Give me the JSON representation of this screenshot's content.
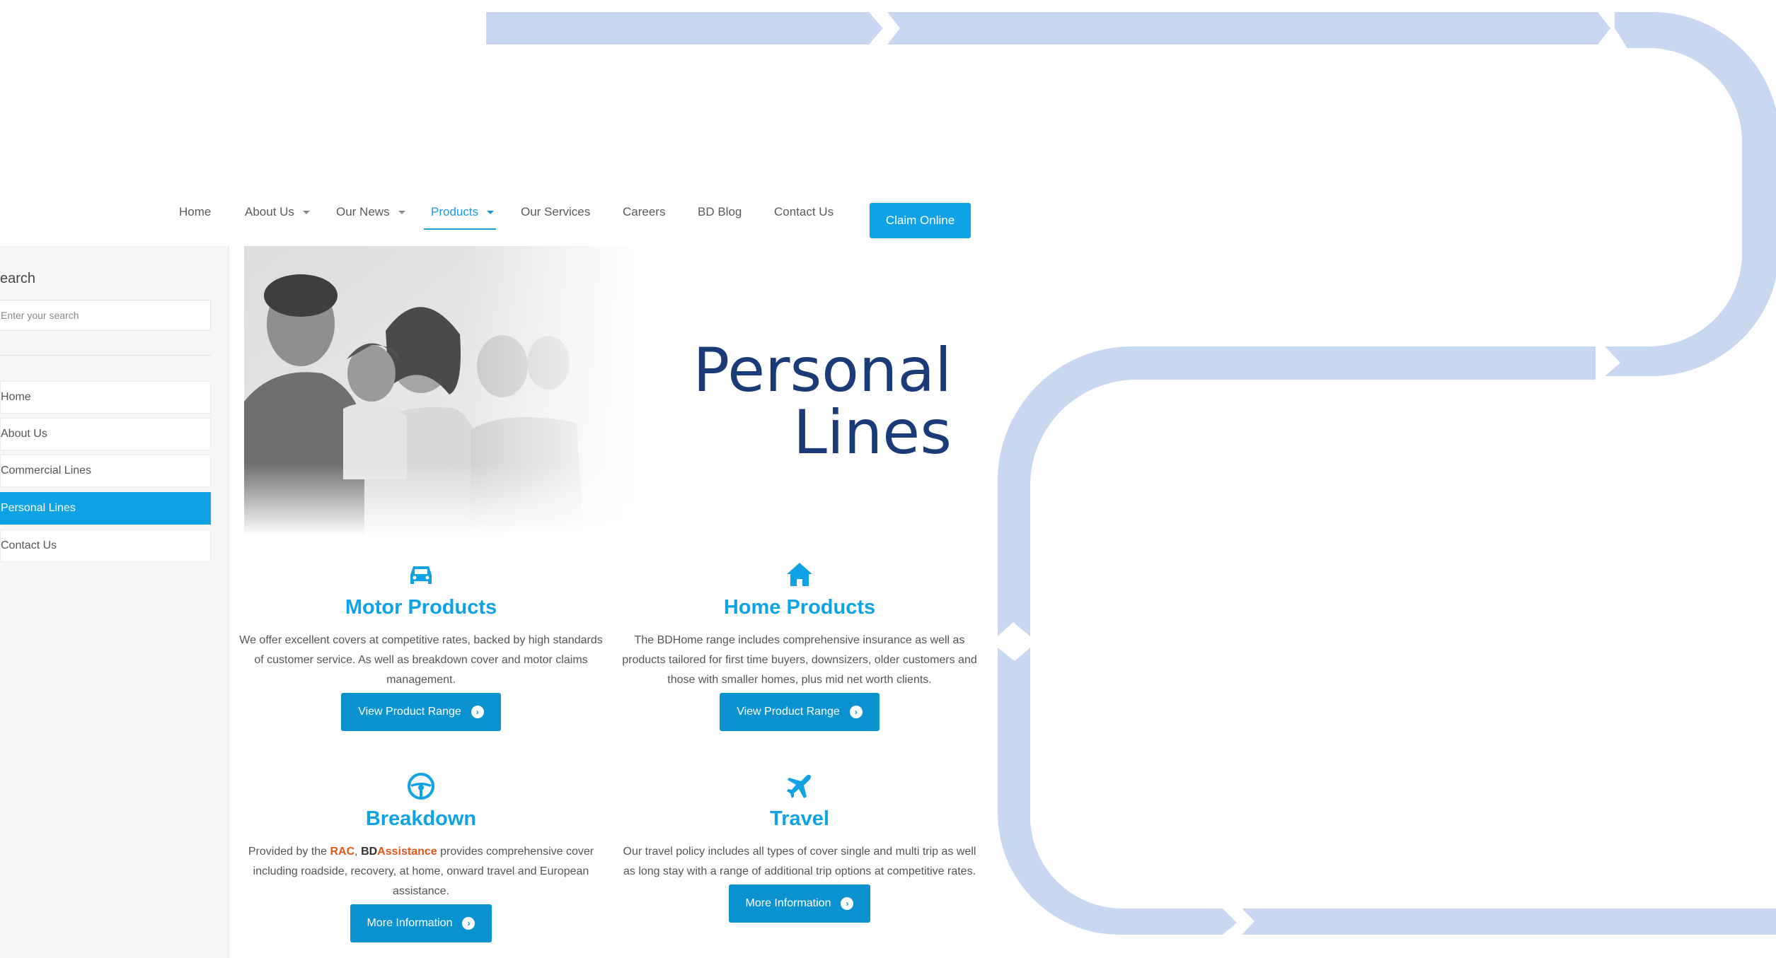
{
  "nav": {
    "items": [
      {
        "label": "Home"
      },
      {
        "label": "About Us"
      },
      {
        "label": "Our News"
      },
      {
        "label": "Products"
      },
      {
        "label": "Our Services"
      },
      {
        "label": "Careers"
      },
      {
        "label": "BD Blog"
      },
      {
        "label": "Contact Us"
      }
    ],
    "active": "Products",
    "claim_label": "Claim Online"
  },
  "sidebar": {
    "search_title": "earch",
    "search_placeholder": "Enter your search",
    "items": [
      {
        "label": "Home"
      },
      {
        "label": "About Us"
      },
      {
        "label": "Commercial Lines"
      },
      {
        "label": "Personal Lines"
      },
      {
        "label": "Contact Us"
      }
    ],
    "active": "Personal Lines"
  },
  "hero": {
    "title_line1": "Personal",
    "title_line2": "Lines"
  },
  "products": [
    {
      "icon": "car-icon",
      "title": "Motor Products",
      "desc": "We offer excellent covers at competitive rates, backed by high standards of customer service. As well as breakdown cover and motor claims management.",
      "button": "View Product Range"
    },
    {
      "icon": "home-icon",
      "title": "Home Products",
      "desc": "The BDHome range includes comprehensive insurance as well as products tailored for first time buyers, downsizers, older customers and those with smaller homes, plus mid net worth clients.",
      "button": "View Product Range"
    },
    {
      "icon": "steering-wheel-icon",
      "title": "Breakdown",
      "desc_prefix": "Provided by the ",
      "desc_rac": "RAC",
      "desc_sep": ", ",
      "desc_bd": "BD",
      "desc_assist": "Assistance",
      "desc_rest": " provides comprehensive cover including roadside, recovery, at home, onward travel and European assistance.",
      "button": "More Information"
    },
    {
      "icon": "plane-icon",
      "title": "Travel",
      "desc": "Our travel policy includes all types of cover single and multi trip as well as long stay with a range of additional trip options at competitive rates.",
      "button": "More Information"
    }
  ],
  "colors": {
    "accent": "#0fa3e6",
    "title_navy": "#1b3b78",
    "decoration": "#c7d8f0",
    "rac_orange": "#e2571c"
  }
}
